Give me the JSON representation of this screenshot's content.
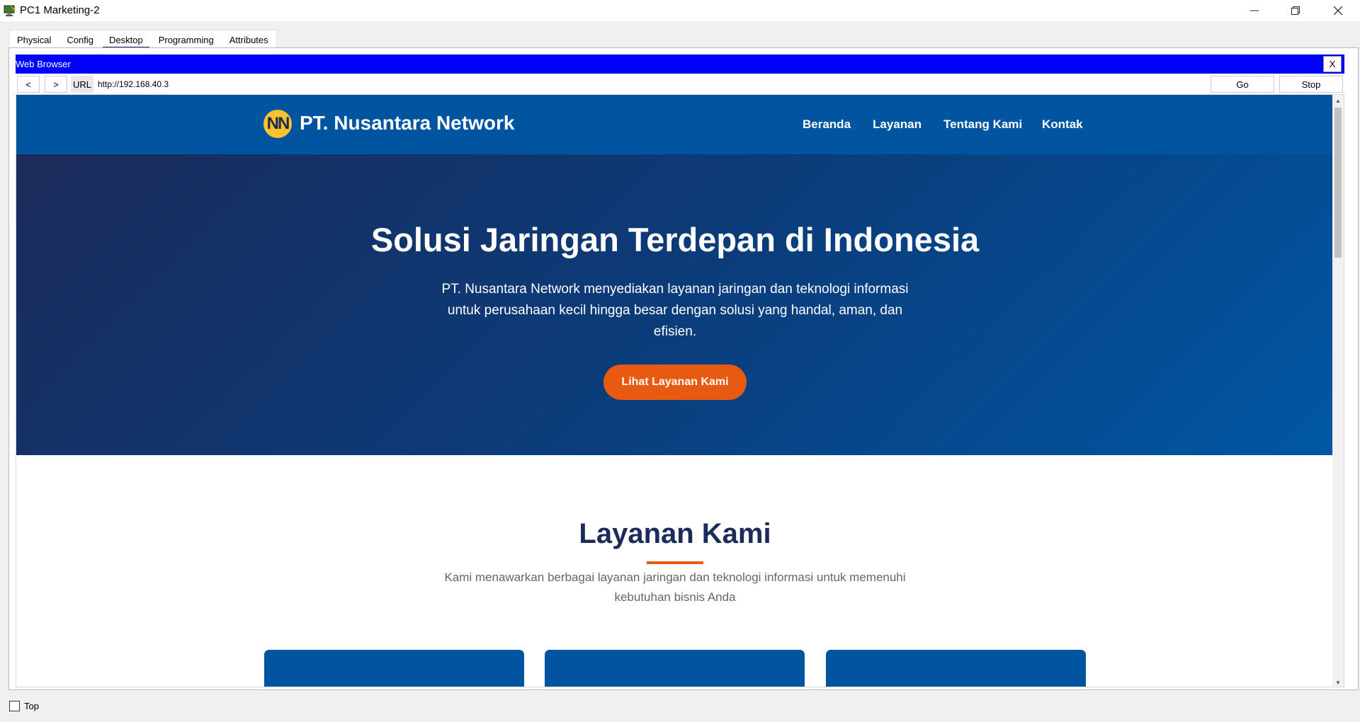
{
  "window": {
    "title": "PC1 Marketing-2",
    "minimize": "—",
    "restore": "❐",
    "close": "✕"
  },
  "tabs": [
    "Physical",
    "Config",
    "Desktop",
    "Programming",
    "Attributes"
  ],
  "active_tab": "Desktop",
  "browser": {
    "title": "Web Browser",
    "close": "X",
    "back": "<",
    "forward": ">",
    "url_label": "URL",
    "url": "http://192.168.40.3",
    "go": "Go",
    "stop": "Stop"
  },
  "site": {
    "logo": "NN",
    "brand": "PT. Nusantara Network",
    "nav": [
      "Beranda",
      "Layanan",
      "Tentang Kami",
      "Kontak"
    ],
    "hero_title": "Solusi Jaringan Terdepan di Indonesia",
    "hero_text": "PT. Nusantara Network menyediakan layanan jaringan dan teknologi informasi untuk perusahaan kecil hingga besar dengan solusi yang handal, aman, dan efisien.",
    "hero_button": "Lihat Layanan Kami",
    "services_title": "Layanan Kami",
    "services_sub": "Kami menawarkan berbagai layanan jaringan dan teknologi informasi untuk memenuhi kebutuhan bisnis Anda"
  },
  "colors": {
    "nav_bg": "#0054a0",
    "accent": "#e85a11",
    "logo": "#f9c22e",
    "browser_title_bar": "#0000ff"
  },
  "bottom": {
    "top_label": "Top"
  }
}
